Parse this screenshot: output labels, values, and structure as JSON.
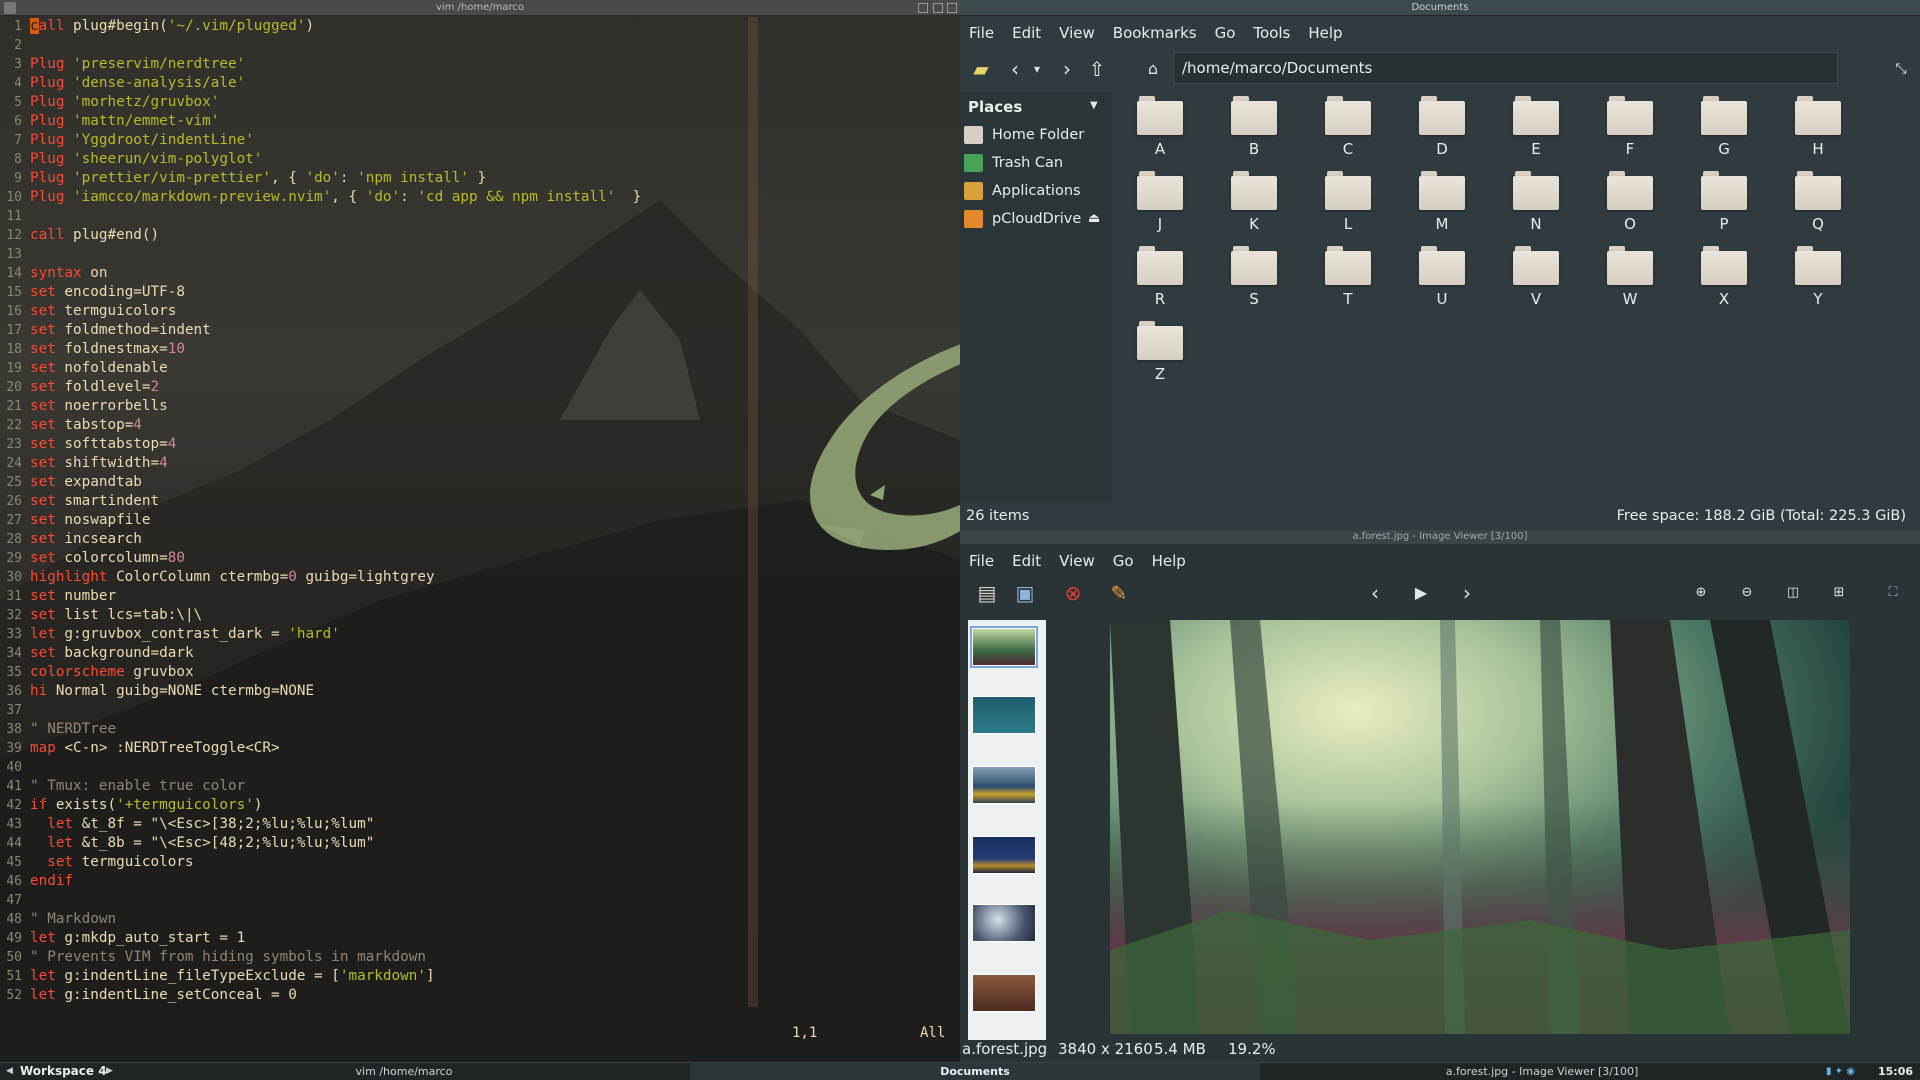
{
  "vim": {
    "title": "vim /home/marco",
    "position": "1,1",
    "scroll": "All",
    "lines": [
      "call plug#begin('~/.vim/plugged')",
      "",
      "Plug 'preservim/nerdtree'",
      "Plug 'dense-analysis/ale'",
      "Plug 'morhetz/gruvbox'",
      "Plug 'mattn/emmet-vim'",
      "Plug 'Yggdroot/indentLine'",
      "Plug 'sheerun/vim-polyglot'",
      "Plug 'prettier/vim-prettier', { 'do': 'npm install' }",
      "Plug 'iamcco/markdown-preview.nvim', { 'do': 'cd app && npm install'  }",
      "",
      "call plug#end()",
      "",
      "syntax on",
      "set encoding=UTF-8",
      "set termguicolors",
      "set foldmethod=indent",
      "set foldnestmax=10",
      "set nofoldenable",
      "set foldlevel=2",
      "set noerrorbells",
      "set tabstop=4",
      "set softtabstop=4",
      "set shiftwidth=4",
      "set expandtab",
      "set smartindent",
      "set noswapfile",
      "set incsearch",
      "set colorcolumn=80",
      "highlight ColorColumn ctermbg=0 guibg=lightgrey",
      "set number",
      "set list lcs=tab:\\|\\",
      "let g:gruvbox_contrast_dark = 'hard'",
      "set background=dark",
      "colorscheme gruvbox",
      "hi Normal guibg=NONE ctermbg=NONE",
      "",
      "\" NERDTree",
      "map <C-n> :NERDTreeToggle<CR>",
      "",
      "\" Tmux: enable true color",
      "if exists('+termguicolors')",
      "  let &t_8f = \"\\<Esc>[38;2;%lu;%lu;%lum\"",
      "  let &t_8b = \"\\<Esc>[48;2;%lu;%lu;%lum\"",
      "  set termguicolors",
      "endif",
      "",
      "\" Markdown",
      "let g:mkdp_auto_start = 1",
      "\" Prevents VIM from hiding symbols in markdown",
      "let g:indentLine_fileTypeExclude = ['markdown']",
      "let g:indentLine_setConceal = 0"
    ]
  },
  "file_manager": {
    "title": "Documents",
    "menu": [
      "File",
      "Edit",
      "View",
      "Bookmarks",
      "Go",
      "Tools",
      "Help"
    ],
    "path": "/home/marco/Documents",
    "places_header": "Places",
    "places": [
      "Home Folder",
      "Trash Can",
      "Applications",
      "pCloudDrive"
    ],
    "folders": [
      "A",
      "B",
      "C",
      "D",
      "E",
      "F",
      "G",
      "H",
      "J",
      "K",
      "L",
      "M",
      "N",
      "O",
      "P",
      "Q",
      "R",
      "S",
      "T",
      "U",
      "V",
      "W",
      "X",
      "Y",
      "Z"
    ],
    "status_left": "26 items",
    "status_right": "Free space: 188.2 GiB (Total: 225.3 GiB)"
  },
  "image_viewer": {
    "title": "a.forest.jpg - Image Viewer [3/100]",
    "menu": [
      "File",
      "Edit",
      "View",
      "Go",
      "Help"
    ],
    "filename": "a.forest.jpg",
    "dimensions": "3840 x 2160",
    "size": "5.4 MB",
    "zoom": "19.2%"
  },
  "taskbar": {
    "workspace": "Workspace 4",
    "tasks": [
      "vim /home/marco",
      "Documents",
      "a.forest.jpg - Image Viewer [3/100]"
    ],
    "clock": "15:06"
  }
}
